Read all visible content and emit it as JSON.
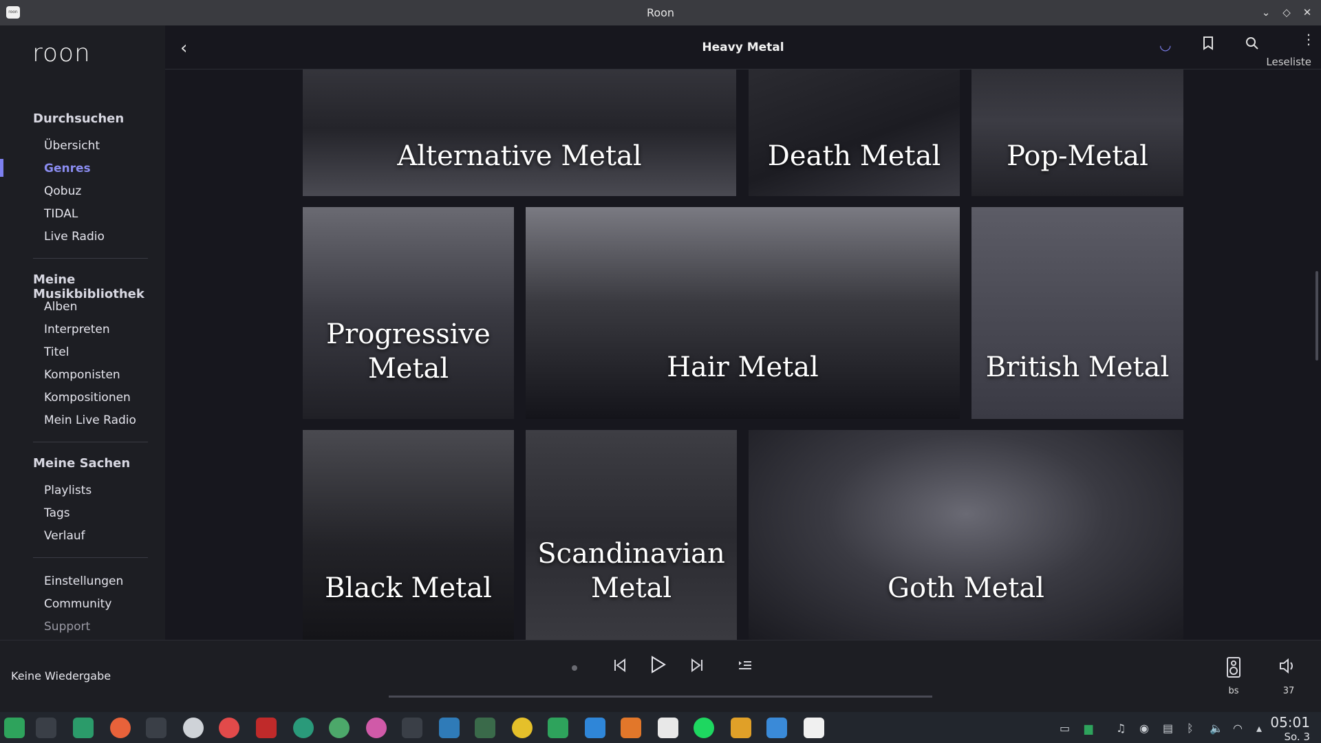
{
  "window": {
    "title": "Roon",
    "app_icon_text": "roon"
  },
  "sidebar": {
    "logo": "roon",
    "sections": [
      {
        "heading": "Durchsuchen",
        "items": [
          "Übersicht",
          "Genres",
          "Qobuz",
          "TIDAL",
          "Live Radio"
        ]
      },
      {
        "heading": "Meine Musikbibliothek",
        "items": [
          "Alben",
          "Interpreten",
          "Titel",
          "Komponisten",
          "Kompositionen",
          "Mein Live Radio"
        ]
      },
      {
        "heading": "Meine Sachen",
        "items": [
          "Playlists",
          "Tags",
          "Verlauf"
        ]
      },
      {
        "heading": "",
        "items": [
          "Einstellungen",
          "Community",
          "Support"
        ]
      }
    ],
    "active_item": "Genres"
  },
  "header": {
    "title": "Heavy Metal",
    "overlay_text": "Leseliste",
    "icons": [
      "back-icon",
      "loading-spinner-icon",
      "bookmark-icon",
      "search-icon",
      "more-icon"
    ]
  },
  "genres": [
    {
      "label": "Alternative Metal"
    },
    {
      "label": "Death Metal"
    },
    {
      "label": "Pop-Metal"
    },
    {
      "label": "Progressive Metal"
    },
    {
      "label": "Hair Metal"
    },
    {
      "label": "British Metal"
    },
    {
      "label": "Black Metal"
    },
    {
      "label": "Scandinavian Metal"
    },
    {
      "label": "Goth Metal"
    }
  ],
  "player": {
    "status": "Keine Wiedergabe",
    "controls": [
      "stop-icon",
      "previous-icon",
      "play-icon",
      "next-icon",
      "queue-icon"
    ],
    "zone_label": "bs",
    "volume": "37"
  },
  "taskbar": {
    "time": "05:01",
    "date": "So. 3"
  },
  "colors": {
    "accent": "#7d80f0",
    "background": "#17171e",
    "sidebar": "#1d1e23"
  }
}
